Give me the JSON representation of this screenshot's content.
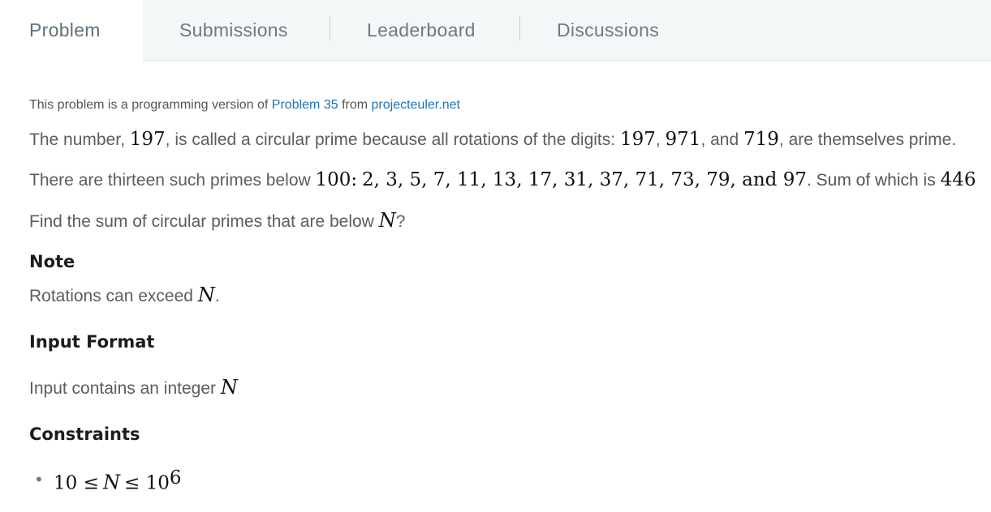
{
  "tabs": [
    {
      "label": "Problem",
      "active": true
    },
    {
      "label": "Submissions",
      "active": false
    },
    {
      "label": "Leaderboard",
      "active": false
    },
    {
      "label": "Discussions",
      "active": false
    }
  ],
  "source": {
    "prefix": "This problem is a programming version of",
    "link_problem": "Problem 35",
    "mid": "from",
    "link_site": "projecteuler.net"
  },
  "statement": {
    "p1_a": "The number,",
    "p1_num1": "197",
    "p1_b": ", is called a circular prime because all rotations of the digits:",
    "p1_rots_a": "197",
    "p1_sep1": ",",
    "p1_rots_b": "971",
    "p1_c": ", and",
    "p1_rots_c": "719",
    "p1_d": ", are themselves prime.",
    "p2_a": "There are thirteen such primes below",
    "p2_limit": "100",
    "p2_colon": ":",
    "p2_list": "2, 3, 5, 7, 11, 13, 17, 31, 37, 71, 73, 79,  and 97",
    "p2_b": ". Sum of which is",
    "p2_sum": "446",
    "p3_a": "Find the sum of circular primes that are below",
    "p3_var": "N",
    "p3_b": "?"
  },
  "note": {
    "heading": "Note",
    "text_a": "Rotations can exceed",
    "var": "N",
    "text_b": "."
  },
  "input_format": {
    "heading": "Input Format",
    "text": "Input contains an integer",
    "var": "N"
  },
  "constraints": {
    "heading": "Constraints",
    "bullet": "•",
    "lhs": "10 ≤",
    "var": "N",
    "rhs": "≤ 10",
    "exp": "6"
  }
}
